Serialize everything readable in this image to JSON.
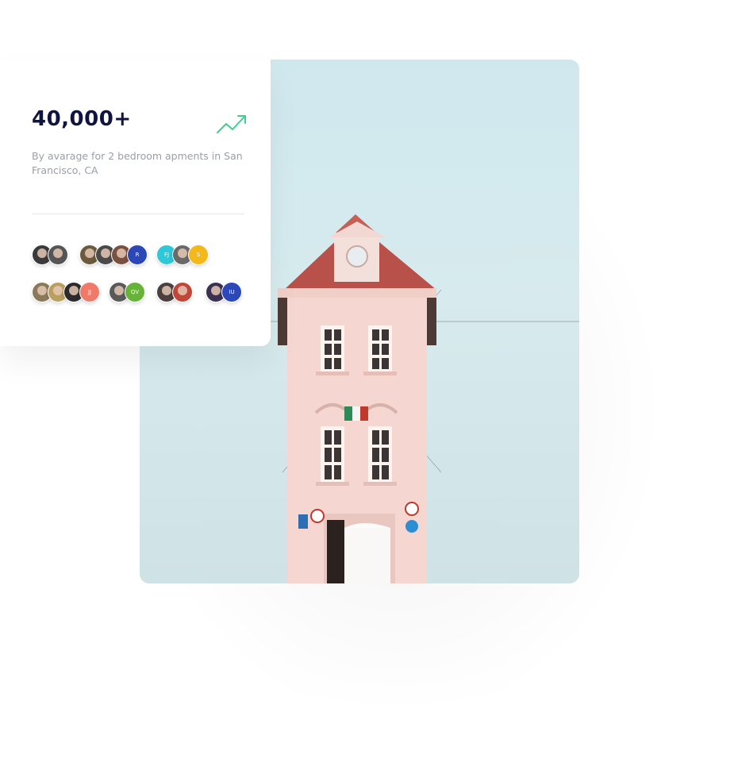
{
  "stat": {
    "value": "40,000+",
    "description": "By avarage for 2 bedroom apments in San Francisco, CA",
    "trend_icon": "trending-up-icon",
    "trend_color": "#3ecf8e"
  },
  "avatar_groups": [
    {
      "avatars": [
        {
          "initials": ""
        },
        {
          "initials": ""
        }
      ]
    },
    {
      "avatars": [
        {
          "initials": ""
        },
        {
          "initials": ""
        },
        {
          "initials": ""
        },
        {
          "initials": "R",
          "color": "#2c47b8"
        }
      ]
    },
    {
      "avatars": [
        {
          "initials": "FJ",
          "color": "#2fc8d8"
        },
        {
          "initials": ""
        },
        {
          "initials": "S",
          "color": "#f2b81c"
        }
      ]
    },
    {
      "avatars": [
        {
          "initials": ""
        },
        {
          "initials": ""
        },
        {
          "initials": ""
        },
        {
          "initials": "JJ",
          "color": "#f07a6a"
        }
      ]
    },
    {
      "avatars": [
        {
          "initials": ""
        },
        {
          "initials": "QV",
          "color": "#67b33a"
        }
      ]
    },
    {
      "avatars": [
        {
          "initials": ""
        },
        {
          "initials": ""
        }
      ]
    },
    {
      "avatars": [
        {
          "initials": ""
        },
        {
          "initials": "IU",
          "color": "#2c47b8"
        }
      ]
    }
  ],
  "colors": {
    "stat_text": "#0f1540",
    "muted_text": "#9b9ea6",
    "sky": "#cfe8ee",
    "building": "#f6d6d0",
    "roof": "#b8514a"
  }
}
